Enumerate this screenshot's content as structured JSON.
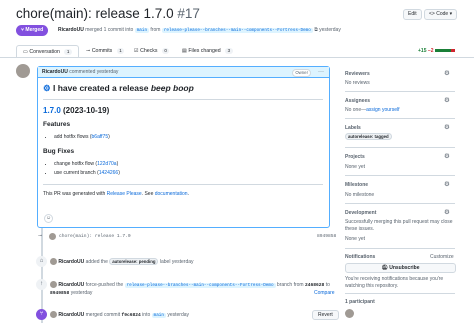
{
  "header": {
    "title": "chore(main): release 1.7.0",
    "number": "#17",
    "edit_label": "Edit",
    "code_label": "Code",
    "status": "Merged",
    "author": "RicardoUU",
    "merge_text": "merged 1 commit into",
    "base_branch": "main",
    "from_text": "from",
    "head_branch": "release-please--branches--main--components--Fortress-Demo",
    "time": "yesterday"
  },
  "tabs": [
    {
      "label": "Conversation",
      "count": "1"
    },
    {
      "label": "Commits",
      "count": "1"
    },
    {
      "label": "Checks",
      "count": "0"
    },
    {
      "label": "Files changed",
      "count": "3"
    }
  ],
  "diffstat": {
    "added": "+15",
    "removed": "−2"
  },
  "comment": {
    "author": "RicardoUU",
    "action": "commented yesterday",
    "role": "Owner",
    "heading": "I have created a release ",
    "heading_em": "beep boop",
    "version": "1.7.0",
    "version_date": " (2023-10-19)",
    "features_title": "Features",
    "feature_item": "add hotfix flows (",
    "feature_hash": "b6aff75",
    "bugfix_title": "Bug Fixes",
    "bug1": "change hotfix flow (",
    "bug1_hash": "122d70a",
    "bug2": "use current branch (",
    "bug2_hash": "1424266",
    "footer_prefix": "This PR was generated with ",
    "footer_link1": "Release Please",
    "footer_mid": ". See ",
    "footer_link2": "documentation",
    "footer_end": "."
  },
  "timeline": {
    "commit_msg": "chore(main): release 1.7.0",
    "commit_sha": "8949858",
    "label_event_user": "RicardoUU",
    "label_event_text": "added the",
    "label_name": "autorelease: pending",
    "label_event_suffix": "label yesterday",
    "force_user": "RicardoUU",
    "force_text": "force-pushed the",
    "force_branch": "release-please--branches--main--components--Fortress-Demo",
    "force_from": "branch from",
    "force_sha1": "2468628",
    "force_to": "to",
    "force_sha2": "8949858",
    "force_time": "yesterday",
    "compare_label": "Compare",
    "merge_user": "RicardoUU",
    "merge_text": "merged commit",
    "merge_sha": "f9c6824",
    "merge_into": "into",
    "merge_branch": "main",
    "merge_time": "yesterday",
    "revert_label": "Revert"
  },
  "sidebar": {
    "reviewers_title": "Reviewers",
    "reviewers_value": "No reviews",
    "assignees_title": "Assignees",
    "assignees_value": "No one—",
    "assignees_link": "assign yourself",
    "labels_title": "Labels",
    "labels_value": "autorelease: tagged",
    "projects_title": "Projects",
    "projects_value": "None yet",
    "milestone_title": "Milestone",
    "milestone_value": "No milestone",
    "development_title": "Development",
    "development_text": "Successfully merging this pull request may close these issues.",
    "development_value": "None yet",
    "notifications_title": "Notifications",
    "customize_label": "Customize",
    "unsubscribe_label": "Unsubscribe",
    "notif_text": "You're receiving notifications because you're watching this repository.",
    "participants": "1 participant"
  }
}
